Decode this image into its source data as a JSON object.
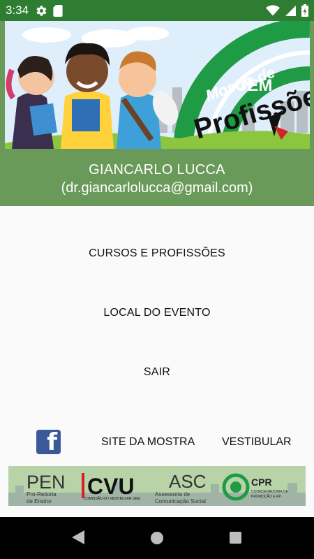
{
  "status_bar": {
    "time": "3:34",
    "icons": [
      "gear-icon",
      "sd-card-icon",
      "wifi-icon",
      "cell-signal-icon",
      "battery-charging-icon"
    ]
  },
  "header": {
    "banner": {
      "line1": "Mostra de",
      "line2": "Profissões",
      "line3": "UEM"
    },
    "user_name": "GIANCARLO LUCCA",
    "user_email": "(dr.giancarlolucca@gmail.com)"
  },
  "menu": {
    "items": [
      {
        "label": "CURSOS E PROFISSÕES"
      },
      {
        "label": "LOCAL DO EVENTO"
      },
      {
        "label": "SAIR"
      }
    ]
  },
  "links": {
    "facebook_glyph": "f",
    "site": "SITE DA MOSTRA",
    "vestibular": "VESTIBULAR"
  },
  "sponsors": {
    "pen": "PEN",
    "pen_sub1": "Pró-Reitoria",
    "pen_sub2": "de Ensino",
    "cvu": "CVU",
    "cvu_sub": "COMISSÃO DO VESTIBULAR UEM",
    "asc": "ASC",
    "asc_sub1": "Assessoria de",
    "asc_sub2": "Comunicação Social",
    "cpr": "CPR",
    "cpr_sub1": "COORDENADORIA DE",
    "cpr_sub2": "PROMOÇÃO E RP"
  },
  "colors": {
    "status_bar": "#2e7d32",
    "header_green": "#6a9a5a",
    "banner_green": "#1f9a45",
    "facebook_blue": "#3b5998"
  }
}
